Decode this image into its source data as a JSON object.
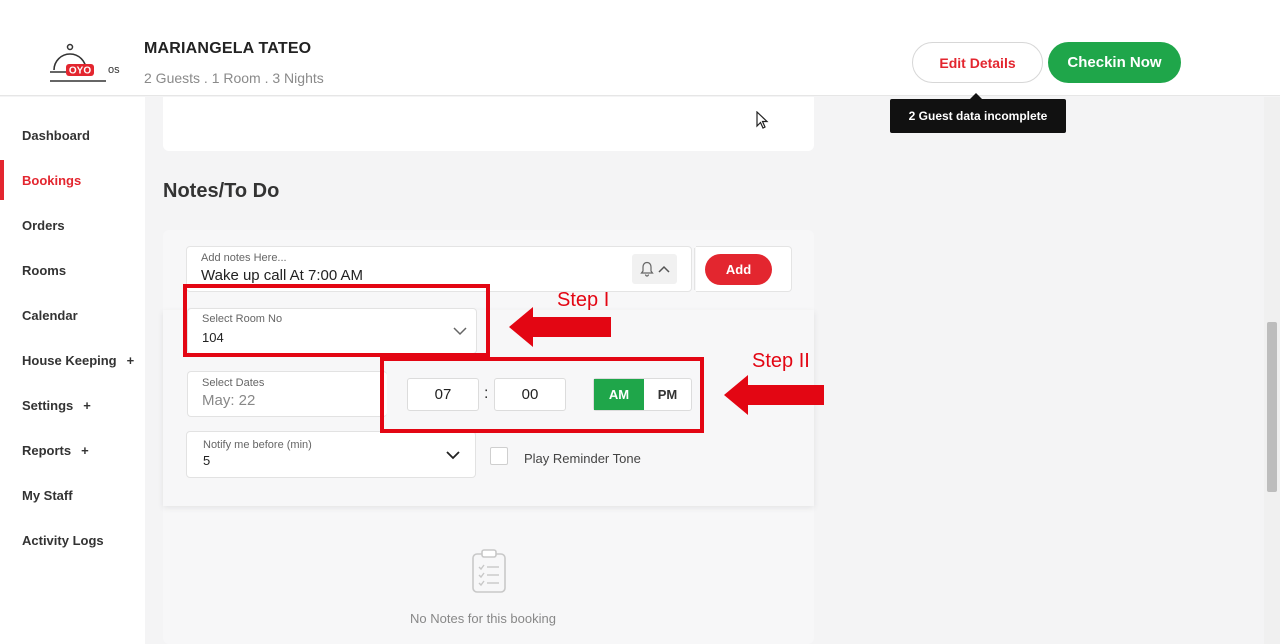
{
  "header": {
    "logo_text": "OYO",
    "logo_suffix": "os",
    "guest_name": "MARIANGELA TATEO",
    "guest_summary": "2 Guests . 1 Room . 3 Nights",
    "edit_button": "Edit Details",
    "checkin_button": "Checkin Now",
    "tooltip": "2 Guest data incomplete"
  },
  "sidebar": {
    "items": [
      {
        "label": "Dashboard",
        "plus": ""
      },
      {
        "label": "Bookings",
        "plus": "",
        "active": true
      },
      {
        "label": "Orders",
        "plus": ""
      },
      {
        "label": "Rooms",
        "plus": ""
      },
      {
        "label": "Calendar",
        "plus": ""
      },
      {
        "label": "House Keeping",
        "plus": "+"
      },
      {
        "label": "Settings",
        "plus": "+"
      },
      {
        "label": "Reports",
        "plus": "+"
      },
      {
        "label": "My Staff",
        "plus": ""
      },
      {
        "label": "Activity Logs",
        "plus": ""
      }
    ]
  },
  "notes": {
    "title": "Notes/To Do",
    "input_placeholder": "Add notes Here...",
    "input_value": "Wake up call At 7:00 AM",
    "add_button": "Add",
    "room_label": "Select Room No",
    "room_value": "104",
    "dates_label": "Select Dates",
    "dates_value": "May: 22",
    "hour": "07",
    "colon": ":",
    "minute": "00",
    "am": "AM",
    "pm": "PM",
    "notify_label": "Notify me before (min)",
    "notify_value": "5",
    "reminder_label": "Play Reminder Tone",
    "empty_text": "No Notes for this booking"
  },
  "annotations": {
    "step1": "Step I",
    "step2": "Step II"
  },
  "colors": {
    "brand_red": "#e3262f",
    "brand_green": "#1fa64a",
    "annotation_red": "#e30613"
  }
}
